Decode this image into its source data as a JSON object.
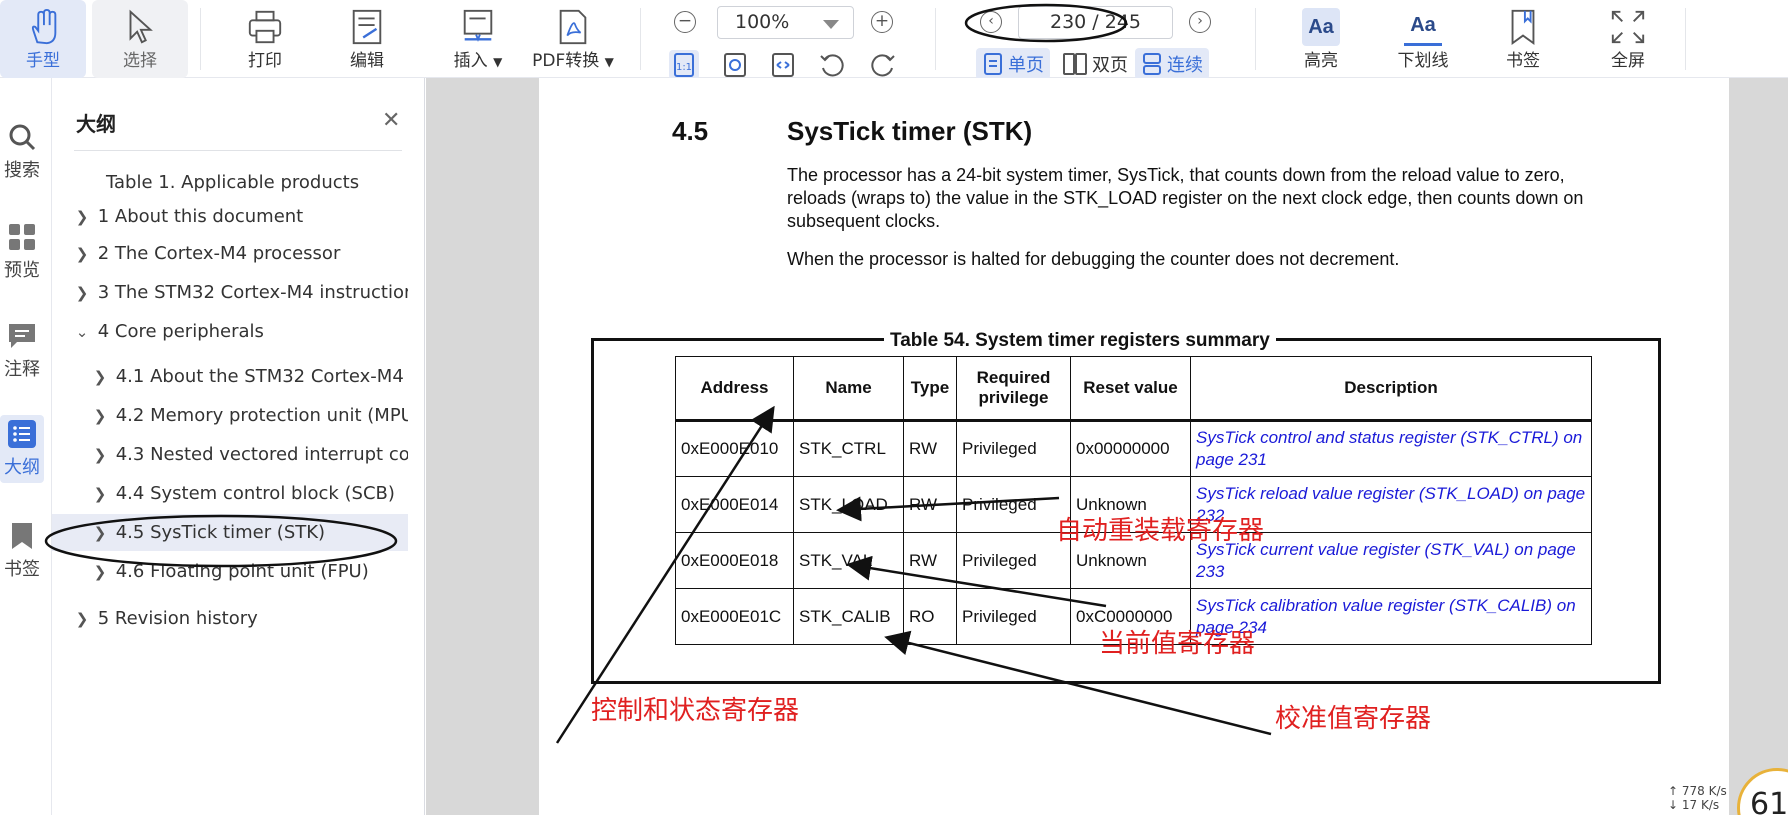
{
  "toolbar": {
    "hand": "手型",
    "select": "选择",
    "print": "打印",
    "edit": "编辑",
    "insert": "插入",
    "pdf_convert": "PDF转换",
    "zoom": "100%",
    "page_indicator": "230 / 245",
    "single": "单页",
    "double": "双页",
    "continuous": "连续",
    "highlight": "高亮",
    "underline": "下划线",
    "bookmark": "书签",
    "fullscreen": "全屏",
    "zoom_fit_label": "1:1"
  },
  "rail": {
    "search": "搜索",
    "preview": "预览",
    "annotate": "注释",
    "outline": "大纲",
    "bookmarks": "书签"
  },
  "outline": {
    "title": "大纲",
    "items": [
      {
        "label": "Table 1. Applicable products"
      },
      {
        "label": "1 About this document"
      },
      {
        "label": "2 The Cortex-M4 processor"
      },
      {
        "label": "3 The STM32 Cortex-M4 instructior"
      },
      {
        "label": "4 Core peripherals"
      },
      {
        "label": "4.1 About the STM32 Cortex-M4"
      },
      {
        "label": "4.2 Memory protection unit (MPU"
      },
      {
        "label": "4.3 Nested vectored interrupt cor"
      },
      {
        "label": "4.4 System control block (SCB)"
      },
      {
        "label": "4.5 SysTick timer (STK)"
      },
      {
        "label": "4.6 Floating point unit (FPU)"
      },
      {
        "label": "5 Revision history"
      }
    ]
  },
  "doc": {
    "section_number": "4.5",
    "section_title": "SysTick timer (STK)",
    "para1": "The processor has a 24-bit system timer, SysTick, that counts down from the reload value to zero, reloads (wraps to) the value in the STK_LOAD register on the next clock edge, then counts down on subsequent clocks.",
    "para2": "When the processor is halted for debugging the counter does not decrement.",
    "table_caption": "Table 54. System timer registers summary",
    "table": {
      "headers": [
        "Address",
        "Name",
        "Type",
        "Required privilege",
        "Reset value",
        "Description"
      ],
      "rows": [
        [
          "0xE000E010",
          "STK_CTRL",
          "RW",
          "Privileged",
          "0x00000000",
          "SysTick control and status register (STK_CTRL) on page 231"
        ],
        [
          "0xE000E014",
          "STK_LOAD",
          "RW",
          "Privileged",
          "Unknown",
          "SysTick reload value register (STK_LOAD) on page 232"
        ],
        [
          "0xE000E018",
          "STK_VAL",
          "RW",
          "Privileged",
          "Unknown",
          "SysTick current value register (STK_VAL) on page 233"
        ],
        [
          "0xE000E01C",
          "STK_CALIB",
          "RO",
          "Privileged",
          "0xC0000000",
          "SysTick calibration value register (STK_CALIB) on page 234"
        ]
      ]
    }
  },
  "annotations": {
    "ctrl": "控制和状态寄存器",
    "load": "自动重装载寄存器",
    "val": "当前值寄存器",
    "calib": "校准值寄存器"
  },
  "status": {
    "upload": "↑ 778 K/s",
    "download": "↓ 17 K/s",
    "badge": "61"
  },
  "colors": {
    "accent": "#3a6fd8",
    "annotation": "#e02020",
    "link": "#1a1ad8"
  }
}
